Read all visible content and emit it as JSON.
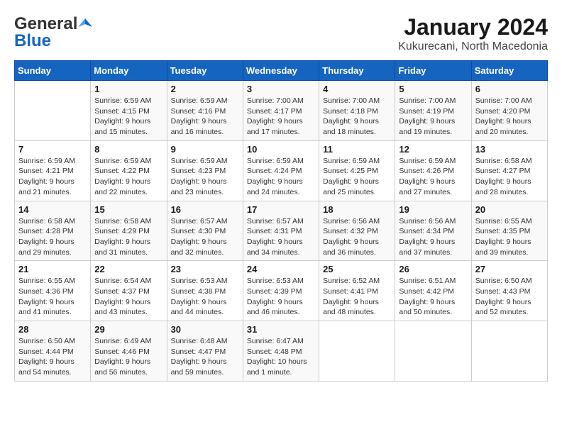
{
  "header": {
    "logo_general": "General",
    "logo_blue": "Blue",
    "title": "January 2024",
    "subtitle": "Kukurecani, North Macedonia"
  },
  "calendar": {
    "days_of_week": [
      "Sunday",
      "Monday",
      "Tuesday",
      "Wednesday",
      "Thursday",
      "Friday",
      "Saturday"
    ],
    "weeks": [
      [
        {
          "day": "",
          "sunrise": "",
          "sunset": "",
          "daylight": ""
        },
        {
          "day": "1",
          "sunrise": "Sunrise: 6:59 AM",
          "sunset": "Sunset: 4:15 PM",
          "daylight": "Daylight: 9 hours and 15 minutes."
        },
        {
          "day": "2",
          "sunrise": "Sunrise: 6:59 AM",
          "sunset": "Sunset: 4:16 PM",
          "daylight": "Daylight: 9 hours and 16 minutes."
        },
        {
          "day": "3",
          "sunrise": "Sunrise: 7:00 AM",
          "sunset": "Sunset: 4:17 PM",
          "daylight": "Daylight: 9 hours and 17 minutes."
        },
        {
          "day": "4",
          "sunrise": "Sunrise: 7:00 AM",
          "sunset": "Sunset: 4:18 PM",
          "daylight": "Daylight: 9 hours and 18 minutes."
        },
        {
          "day": "5",
          "sunrise": "Sunrise: 7:00 AM",
          "sunset": "Sunset: 4:19 PM",
          "daylight": "Daylight: 9 hours and 19 minutes."
        },
        {
          "day": "6",
          "sunrise": "Sunrise: 7:00 AM",
          "sunset": "Sunset: 4:20 PM",
          "daylight": "Daylight: 9 hours and 20 minutes."
        }
      ],
      [
        {
          "day": "7",
          "sunrise": "Sunrise: 6:59 AM",
          "sunset": "Sunset: 4:21 PM",
          "daylight": "Daylight: 9 hours and 21 minutes."
        },
        {
          "day": "8",
          "sunrise": "Sunrise: 6:59 AM",
          "sunset": "Sunset: 4:22 PM",
          "daylight": "Daylight: 9 hours and 22 minutes."
        },
        {
          "day": "9",
          "sunrise": "Sunrise: 6:59 AM",
          "sunset": "Sunset: 4:23 PM",
          "daylight": "Daylight: 9 hours and 23 minutes."
        },
        {
          "day": "10",
          "sunrise": "Sunrise: 6:59 AM",
          "sunset": "Sunset: 4:24 PM",
          "daylight": "Daylight: 9 hours and 24 minutes."
        },
        {
          "day": "11",
          "sunrise": "Sunrise: 6:59 AM",
          "sunset": "Sunset: 4:25 PM",
          "daylight": "Daylight: 9 hours and 25 minutes."
        },
        {
          "day": "12",
          "sunrise": "Sunrise: 6:59 AM",
          "sunset": "Sunset: 4:26 PM",
          "daylight": "Daylight: 9 hours and 27 minutes."
        },
        {
          "day": "13",
          "sunrise": "Sunrise: 6:58 AM",
          "sunset": "Sunset: 4:27 PM",
          "daylight": "Daylight: 9 hours and 28 minutes."
        }
      ],
      [
        {
          "day": "14",
          "sunrise": "Sunrise: 6:58 AM",
          "sunset": "Sunset: 4:28 PM",
          "daylight": "Daylight: 9 hours and 29 minutes."
        },
        {
          "day": "15",
          "sunrise": "Sunrise: 6:58 AM",
          "sunset": "Sunset: 4:29 PM",
          "daylight": "Daylight: 9 hours and 31 minutes."
        },
        {
          "day": "16",
          "sunrise": "Sunrise: 6:57 AM",
          "sunset": "Sunset: 4:30 PM",
          "daylight": "Daylight: 9 hours and 32 minutes."
        },
        {
          "day": "17",
          "sunrise": "Sunrise: 6:57 AM",
          "sunset": "Sunset: 4:31 PM",
          "daylight": "Daylight: 9 hours and 34 minutes."
        },
        {
          "day": "18",
          "sunrise": "Sunrise: 6:56 AM",
          "sunset": "Sunset: 4:32 PM",
          "daylight": "Daylight: 9 hours and 36 minutes."
        },
        {
          "day": "19",
          "sunrise": "Sunrise: 6:56 AM",
          "sunset": "Sunset: 4:34 PM",
          "daylight": "Daylight: 9 hours and 37 minutes."
        },
        {
          "day": "20",
          "sunrise": "Sunrise: 6:55 AM",
          "sunset": "Sunset: 4:35 PM",
          "daylight": "Daylight: 9 hours and 39 minutes."
        }
      ],
      [
        {
          "day": "21",
          "sunrise": "Sunrise: 6:55 AM",
          "sunset": "Sunset: 4:36 PM",
          "daylight": "Daylight: 9 hours and 41 minutes."
        },
        {
          "day": "22",
          "sunrise": "Sunrise: 6:54 AM",
          "sunset": "Sunset: 4:37 PM",
          "daylight": "Daylight: 9 hours and 43 minutes."
        },
        {
          "day": "23",
          "sunrise": "Sunrise: 6:53 AM",
          "sunset": "Sunset: 4:38 PM",
          "daylight": "Daylight: 9 hours and 44 minutes."
        },
        {
          "day": "24",
          "sunrise": "Sunrise: 6:53 AM",
          "sunset": "Sunset: 4:39 PM",
          "daylight": "Daylight: 9 hours and 46 minutes."
        },
        {
          "day": "25",
          "sunrise": "Sunrise: 6:52 AM",
          "sunset": "Sunset: 4:41 PM",
          "daylight": "Daylight: 9 hours and 48 minutes."
        },
        {
          "day": "26",
          "sunrise": "Sunrise: 6:51 AM",
          "sunset": "Sunset: 4:42 PM",
          "daylight": "Daylight: 9 hours and 50 minutes."
        },
        {
          "day": "27",
          "sunrise": "Sunrise: 6:50 AM",
          "sunset": "Sunset: 4:43 PM",
          "daylight": "Daylight: 9 hours and 52 minutes."
        }
      ],
      [
        {
          "day": "28",
          "sunrise": "Sunrise: 6:50 AM",
          "sunset": "Sunset: 4:44 PM",
          "daylight": "Daylight: 9 hours and 54 minutes."
        },
        {
          "day": "29",
          "sunrise": "Sunrise: 6:49 AM",
          "sunset": "Sunset: 4:46 PM",
          "daylight": "Daylight: 9 hours and 56 minutes."
        },
        {
          "day": "30",
          "sunrise": "Sunrise: 6:48 AM",
          "sunset": "Sunset: 4:47 PM",
          "daylight": "Daylight: 9 hours and 59 minutes."
        },
        {
          "day": "31",
          "sunrise": "Sunrise: 6:47 AM",
          "sunset": "Sunset: 4:48 PM",
          "daylight": "Daylight: 10 hours and 1 minute."
        },
        {
          "day": "",
          "sunrise": "",
          "sunset": "",
          "daylight": ""
        },
        {
          "day": "",
          "sunrise": "",
          "sunset": "",
          "daylight": ""
        },
        {
          "day": "",
          "sunrise": "",
          "sunset": "",
          "daylight": ""
        }
      ]
    ]
  }
}
